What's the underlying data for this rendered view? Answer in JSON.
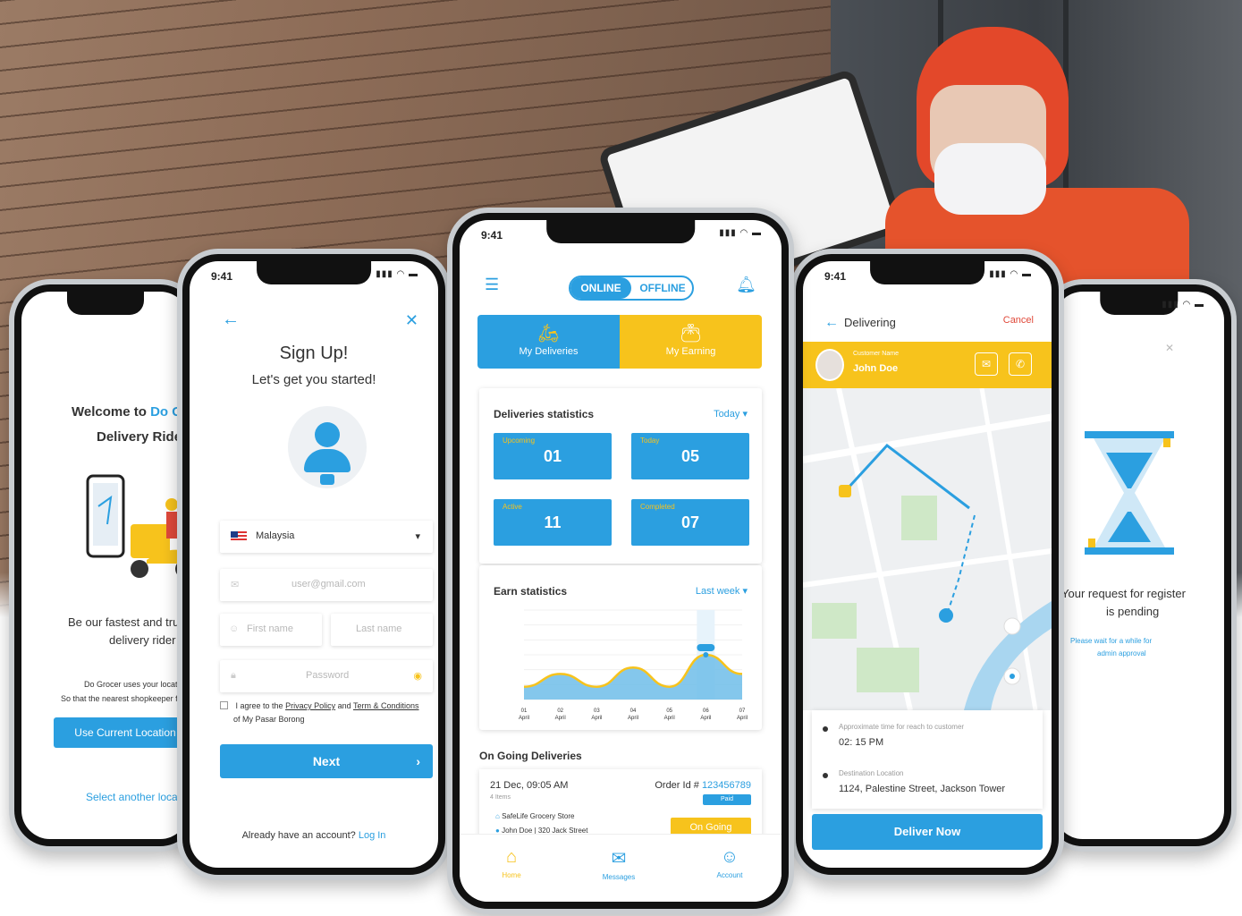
{
  "colors": {
    "primary": "#2b9fe0",
    "accent": "#f7c31c",
    "danger": "#e0493a"
  },
  "screen1": {
    "welcome_prefix": "Welcome to",
    "brand": "Do Groce",
    "subtitle": "Delivery Rider",
    "tagline_1": "Be our fastest and truste",
    "tagline_2": "delivery rider",
    "note_1": "Do Grocer uses your location",
    "note_2": "So that the nearest shopkeeper finds",
    "cta": "Use Current Location",
    "alt_link": "Select another location"
  },
  "screen2": {
    "time": "9:41",
    "title": "Sign Up!",
    "subtitle": "Let's get you started!",
    "country": "Malaysia",
    "email_placeholder": "user@gmail.com",
    "first_name_placeholder": "First name",
    "last_name_placeholder": "Last name",
    "password_placeholder": "Password",
    "agree_prefix": "I agree to the",
    "privacy": "Privacy Policy",
    "and": "and",
    "terms": "Term & Conditions",
    "agree_suffix": "of My Pasar Borong",
    "next": "Next",
    "already": "Already have an account?",
    "login": "Log In"
  },
  "screen3": {
    "time": "9:41",
    "online": "ONLINE",
    "offline": "OFFLINE",
    "tab_deliveries": "My Deliveries",
    "tab_earning": "My Earning",
    "deliveries_title": "Deliveries statistics",
    "deliveries_filter": "Today",
    "stats": [
      {
        "label": "Upcoming",
        "value": "01"
      },
      {
        "label": "Today",
        "value": "05"
      },
      {
        "label": "Active",
        "value": "11"
      },
      {
        "label": "Completed",
        "value": "07"
      }
    ],
    "earn_title": "Earn statistics",
    "earn_filter": "Last week",
    "ongoing_title": "On Going Deliveries",
    "order": {
      "date": "21 Dec, 09:05 AM",
      "items": "4 Items",
      "order_label": "Order Id #",
      "order_id": "123456789",
      "paid": "Paid",
      "store": "SafeLife Grocery Store",
      "customer": "John Doe | 320 Jack Street",
      "status": "On Going"
    },
    "nav": [
      "Home",
      "Messages",
      "Account"
    ]
  },
  "chart_data": {
    "type": "area",
    "x": [
      "01 April",
      "02 April",
      "03 April",
      "04 April",
      "05 April",
      "06 April",
      "07 April"
    ],
    "series": [
      {
        "values": [
          3.1,
          3.3,
          3.1,
          3.4,
          3.1,
          3.6,
          3.3
        ]
      }
    ],
    "ylim": [
      2.9,
      4.3
    ],
    "highlight_index": 5
  },
  "screen4": {
    "time": "9:41",
    "title": "Delivering",
    "cancel": "Cancel",
    "customer_label": "Customer Name",
    "customer_name": "John Doe",
    "eta_label": "Approximate time for reach to customer",
    "eta": "02: 15 PM",
    "dest_label": "Destination Location",
    "dest": "1124, Palestine Street, Jackson Tower",
    "cta": "Deliver Now"
  },
  "screen5": {
    "pending_1": "Your request for register",
    "pending_2": "is pending",
    "wait_1": "Please wait for a while for",
    "wait_2": "admin approval"
  }
}
